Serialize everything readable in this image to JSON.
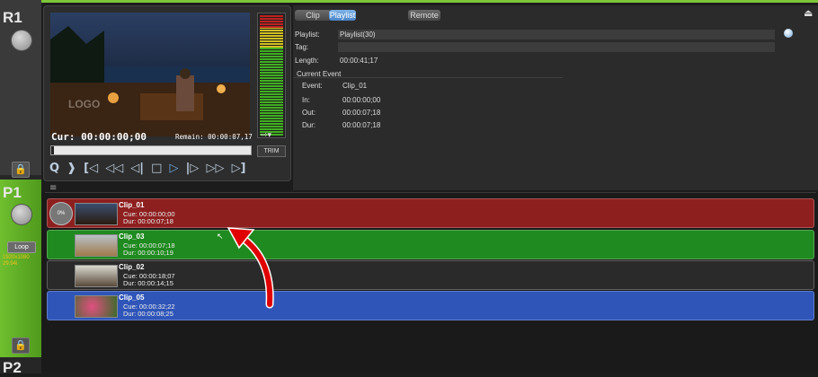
{
  "channels": {
    "r1": "R1",
    "p1": "P1",
    "p2": "P2",
    "loop_label": "Loop",
    "format_line1": "1920x1080",
    "format_line2": "29.94i"
  },
  "player": {
    "cur_label": "Cur:",
    "cur_time": "00:00:00;00",
    "remain_label": "Remain:",
    "remain_time": "00:00:07,17",
    "trim_label": "TRIM",
    "watermark": "LOGO"
  },
  "tabs": {
    "clip": "Clip",
    "playlist": "Playlist",
    "remote": "Remote"
  },
  "info": {
    "playlist_label": "Playlist:",
    "playlist_value": "Playlist(30)",
    "tag_label": "Tag:",
    "tag_value": "",
    "length_label": "Length:",
    "length_value": "00:00:41;17",
    "current_event_label": "Current Event",
    "event_label": "Event:",
    "event_value": "Clip_01",
    "in_label": "In:",
    "in_value": "00:00:00;00",
    "out_label": "Out:",
    "out_value": "00:00:07;18",
    "dur_label": "Dur:",
    "dur_value": "00:00:07;18"
  },
  "playlist_items": [
    {
      "name": "Clip_01",
      "cue": "Cue: 00:00:00;00",
      "dur": "Dur: 00:00:07;18",
      "color": "#8e1f1f",
      "progress": "0%"
    },
    {
      "name": "Clip_03",
      "cue": "Cue: 00:00:07;18",
      "dur": "Dur: 00:00:10;19",
      "color": "#1f8a1f"
    },
    {
      "name": "Clip_02",
      "cue": "Cue: 00:00:18;07",
      "dur": "Dur: 00:00:14;15",
      "color": "#2a2a2a"
    },
    {
      "name": "Clip_05",
      "cue": "Cue: 00:00:32;22",
      "dur": "Dur: 00:00:08;25",
      "color": "#2f55b8"
    }
  ],
  "colors": {
    "accent": "#6fa8dc",
    "green": "#7dc63a",
    "red_row": "#8e1f1f",
    "green_row": "#1f8a1f",
    "blue_row": "#2f55b8"
  },
  "icons": [
    "eject-icon",
    "lock-icon",
    "mark-in-icon",
    "mark-out-icon",
    "goto-in-icon",
    "fast-rewind-icon",
    "step-back-icon",
    "stop-icon",
    "play-icon",
    "step-forward-icon",
    "fast-forward-icon",
    "goto-out-icon",
    "playlist-list-icon",
    "send-to-icon"
  ]
}
